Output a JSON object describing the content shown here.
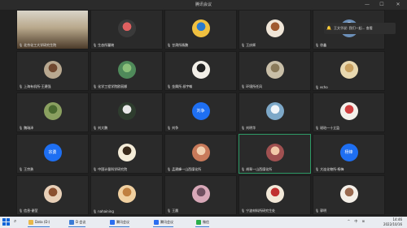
{
  "window": {
    "title": "腾讯会议",
    "controls": [
      "—",
      "☐",
      "✕"
    ]
  },
  "notification": {
    "text": "王文华说: 我们一起... 查看"
  },
  "tiles": [
    {
      "name": "北京化工大学研究生院",
      "kind": "video"
    },
    {
      "name": "生态所瞿晓",
      "kind": "avatar",
      "color": "#3a3a3a",
      "accent": "#e06060"
    },
    {
      "name": "甘肃所杨鹏",
      "kind": "avatar",
      "color": "#f0c040",
      "accent": "#2a7ad0"
    },
    {
      "name": "王庆辉",
      "kind": "avatar",
      "color": "#f0e6d8",
      "accent": "#a05a30"
    },
    {
      "name": "徐鑫",
      "kind": "avatar",
      "color": "#6b8fb8",
      "accent": "#ffffff"
    },
    {
      "name": "上海有机所-王建强",
      "kind": "avatar",
      "color": "#b8a890",
      "accent": "#704830"
    },
    {
      "name": "化学工程学院欧丽娜",
      "kind": "avatar",
      "color": "#4f8a5a",
      "accent": "#8bc07a"
    },
    {
      "name": "金属所 叔宇翰",
      "kind": "avatar",
      "color": "#f2efe8",
      "accent": "#222222"
    },
    {
      "name": "环境所任风",
      "kind": "avatar",
      "color": "#c9bfa8",
      "accent": "#8a7a5a"
    },
    {
      "name": "echo",
      "kind": "avatar",
      "color": "#e8d8b0",
      "accent": "#c8a060"
    },
    {
      "name": "魏瑞泽",
      "kind": "avatar",
      "color": "#8aa060",
      "accent": "#4a6a30"
    },
    {
      "name": "刘大鹏",
      "kind": "avatar",
      "color": "#2e3d2e",
      "accent": "#e8e8e8"
    },
    {
      "name": "刘争",
      "kind": "text",
      "initials": "刘争"
    },
    {
      "name": "刘明华",
      "kind": "avatar",
      "color": "#7da8c8",
      "accent": "#f0f4f8"
    },
    {
      "name": "琥珀一十立监",
      "kind": "avatar",
      "color": "#f3f0ea",
      "accent": "#d04040"
    },
    {
      "name": "王宗勇",
      "kind": "text",
      "initials": "宗勇"
    },
    {
      "name": "中国计量科学研究院",
      "kind": "avatar",
      "color": "#f4ecd8",
      "accent": "#3a2a1a"
    },
    {
      "name": "孟建峰—山西煤化所",
      "kind": "avatar",
      "color": "#c87a5a",
      "accent": "#f0d0b0"
    },
    {
      "name": "胡翠—山西煤化所",
      "kind": "avatar",
      "color": "#a05050",
      "accent": "#f2c8a8"
    },
    {
      "name": "大连化物所-杨锋",
      "kind": "text",
      "initials": "杨锋"
    },
    {
      "name": "信息-谢堃",
      "kind": "avatar",
      "color": "#e8d0b8",
      "accent": "#8a5030"
    },
    {
      "name": "nahaining",
      "kind": "avatar",
      "color": "#f0d0a0",
      "accent": "#c08040"
    },
    {
      "name": "王晨",
      "kind": "avatar",
      "color": "#d8a8b8",
      "accent": "#705060"
    },
    {
      "name": "宁波材料所研究生处",
      "kind": "avatar",
      "color": "#f2e8d8",
      "accent": "#c03030"
    },
    {
      "name": "郭明",
      "kind": "avatar",
      "color": "#f4efe8",
      "accent": "#9a6a50"
    }
  ],
  "taskbar": {
    "items": [
      {
        "label": "Data (D:)",
        "color": "#e8b84a"
      },
      {
        "label": "D 会议",
        "color": "#3a7bd5"
      },
      {
        "label": "腾讯会议",
        "color": "#2a6ef0"
      },
      {
        "label": "腾讯会议",
        "color": "#2a6ef0"
      },
      {
        "label": "微信",
        "color": "#2aae4a"
      }
    ],
    "tray": "^ 中 ⊞",
    "time": "14:46",
    "date": "2022/10/16"
  }
}
